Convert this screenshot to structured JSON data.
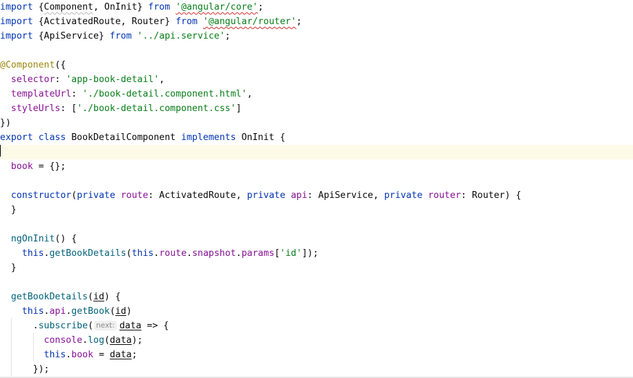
{
  "code": {
    "l1": {
      "kw_import": "import",
      "open": " {",
      "component": "Component",
      "comma": ", ",
      "oninit": "OnInit",
      "close": "} ",
      "kw_from": "from",
      "space": " ",
      "path": "'@angular/core'",
      "semi": ";"
    },
    "l2": {
      "kw_import": "import",
      "body": " {ActivatedRoute, Router} ",
      "kw_from": "from",
      "space": " ",
      "path": "'@angular/router'",
      "semi": ";"
    },
    "l3": {
      "kw_import": "import",
      "body": " {ApiService} ",
      "kw_from": "from",
      "path": " '../api.service'",
      "semi": ";"
    },
    "l5": {
      "decorator": "@Component",
      "rest": "({"
    },
    "l6": {
      "indent": "  ",
      "key": "selector",
      "colon": ": ",
      "value": "'app-book-detail'",
      "comma": ","
    },
    "l7": {
      "indent": "  ",
      "key": "templateUrl",
      "colon": ": ",
      "value": "'./book-detail.component.html'",
      "comma": ","
    },
    "l8": {
      "indent": "  ",
      "key": "styleUrls",
      "colon": ": [",
      "value": "'./book-detail.component.css'",
      "close": "]"
    },
    "l9": {
      "text": "})"
    },
    "l10": {
      "kw_export": "export",
      "kw_class": " class",
      "name": " BookDetailComponent ",
      "kw_implements": "implements",
      "rest": " OnInit {"
    },
    "l12": {
      "indent": "  ",
      "field": "book",
      "rest": " = {};"
    },
    "l14": {
      "indent": "  ",
      "kw_constructor": "constructor",
      "p1": "(",
      "kw_private1": "private",
      "route": " route",
      "type1": ": ActivatedRoute, ",
      "kw_private2": "private",
      "api": " api",
      "type2": ": ApiService, ",
      "kw_private3": "private",
      "router": " router",
      "type3": ": Router) {"
    },
    "l15": {
      "text": "  }"
    },
    "l17": {
      "indent": "  ",
      "method": "ngOnInit",
      "rest": "() {"
    },
    "l18": {
      "indent": "    ",
      "kw_this": "this",
      "dot": ".",
      "method": "getBookDetails",
      "paren": "(",
      "kw_this2": "this",
      "dot2": ".",
      "route": "route",
      "dot3": ".",
      "snapshot": "snapshot",
      "dot4": ".",
      "params": "params",
      "bracket": "[",
      "key": "'id'",
      "end": "]);"
    },
    "l19": {
      "text": "  }"
    },
    "l21": {
      "indent": "  ",
      "method": "getBookDetails",
      "paren": "(",
      "param": "id",
      "rest": ") {"
    },
    "l22": {
      "indent": "    ",
      "kw_this": "this",
      "dot": ".",
      "api": "api",
      "dot2": ".",
      "method": "getBook",
      "paren": "(",
      "param": "id",
      "close": ")"
    },
    "l23": {
      "indent": "      ",
      "dot": ".",
      "method": "subscribe",
      "paren": "(",
      "hint": "next:",
      "param": "data",
      "rest": " => {"
    },
    "l24": {
      "indent": "        ",
      "obj": "console",
      "dot": ".",
      "method": "log",
      "paren": "(",
      "param": "data",
      "rest": ");"
    },
    "l25": {
      "indent": "        ",
      "kw_this": "this",
      "dot": ".",
      "field": "book",
      "eq": " = ",
      "param": "data",
      "semi": ";"
    },
    "l26": {
      "text": "      });"
    }
  }
}
